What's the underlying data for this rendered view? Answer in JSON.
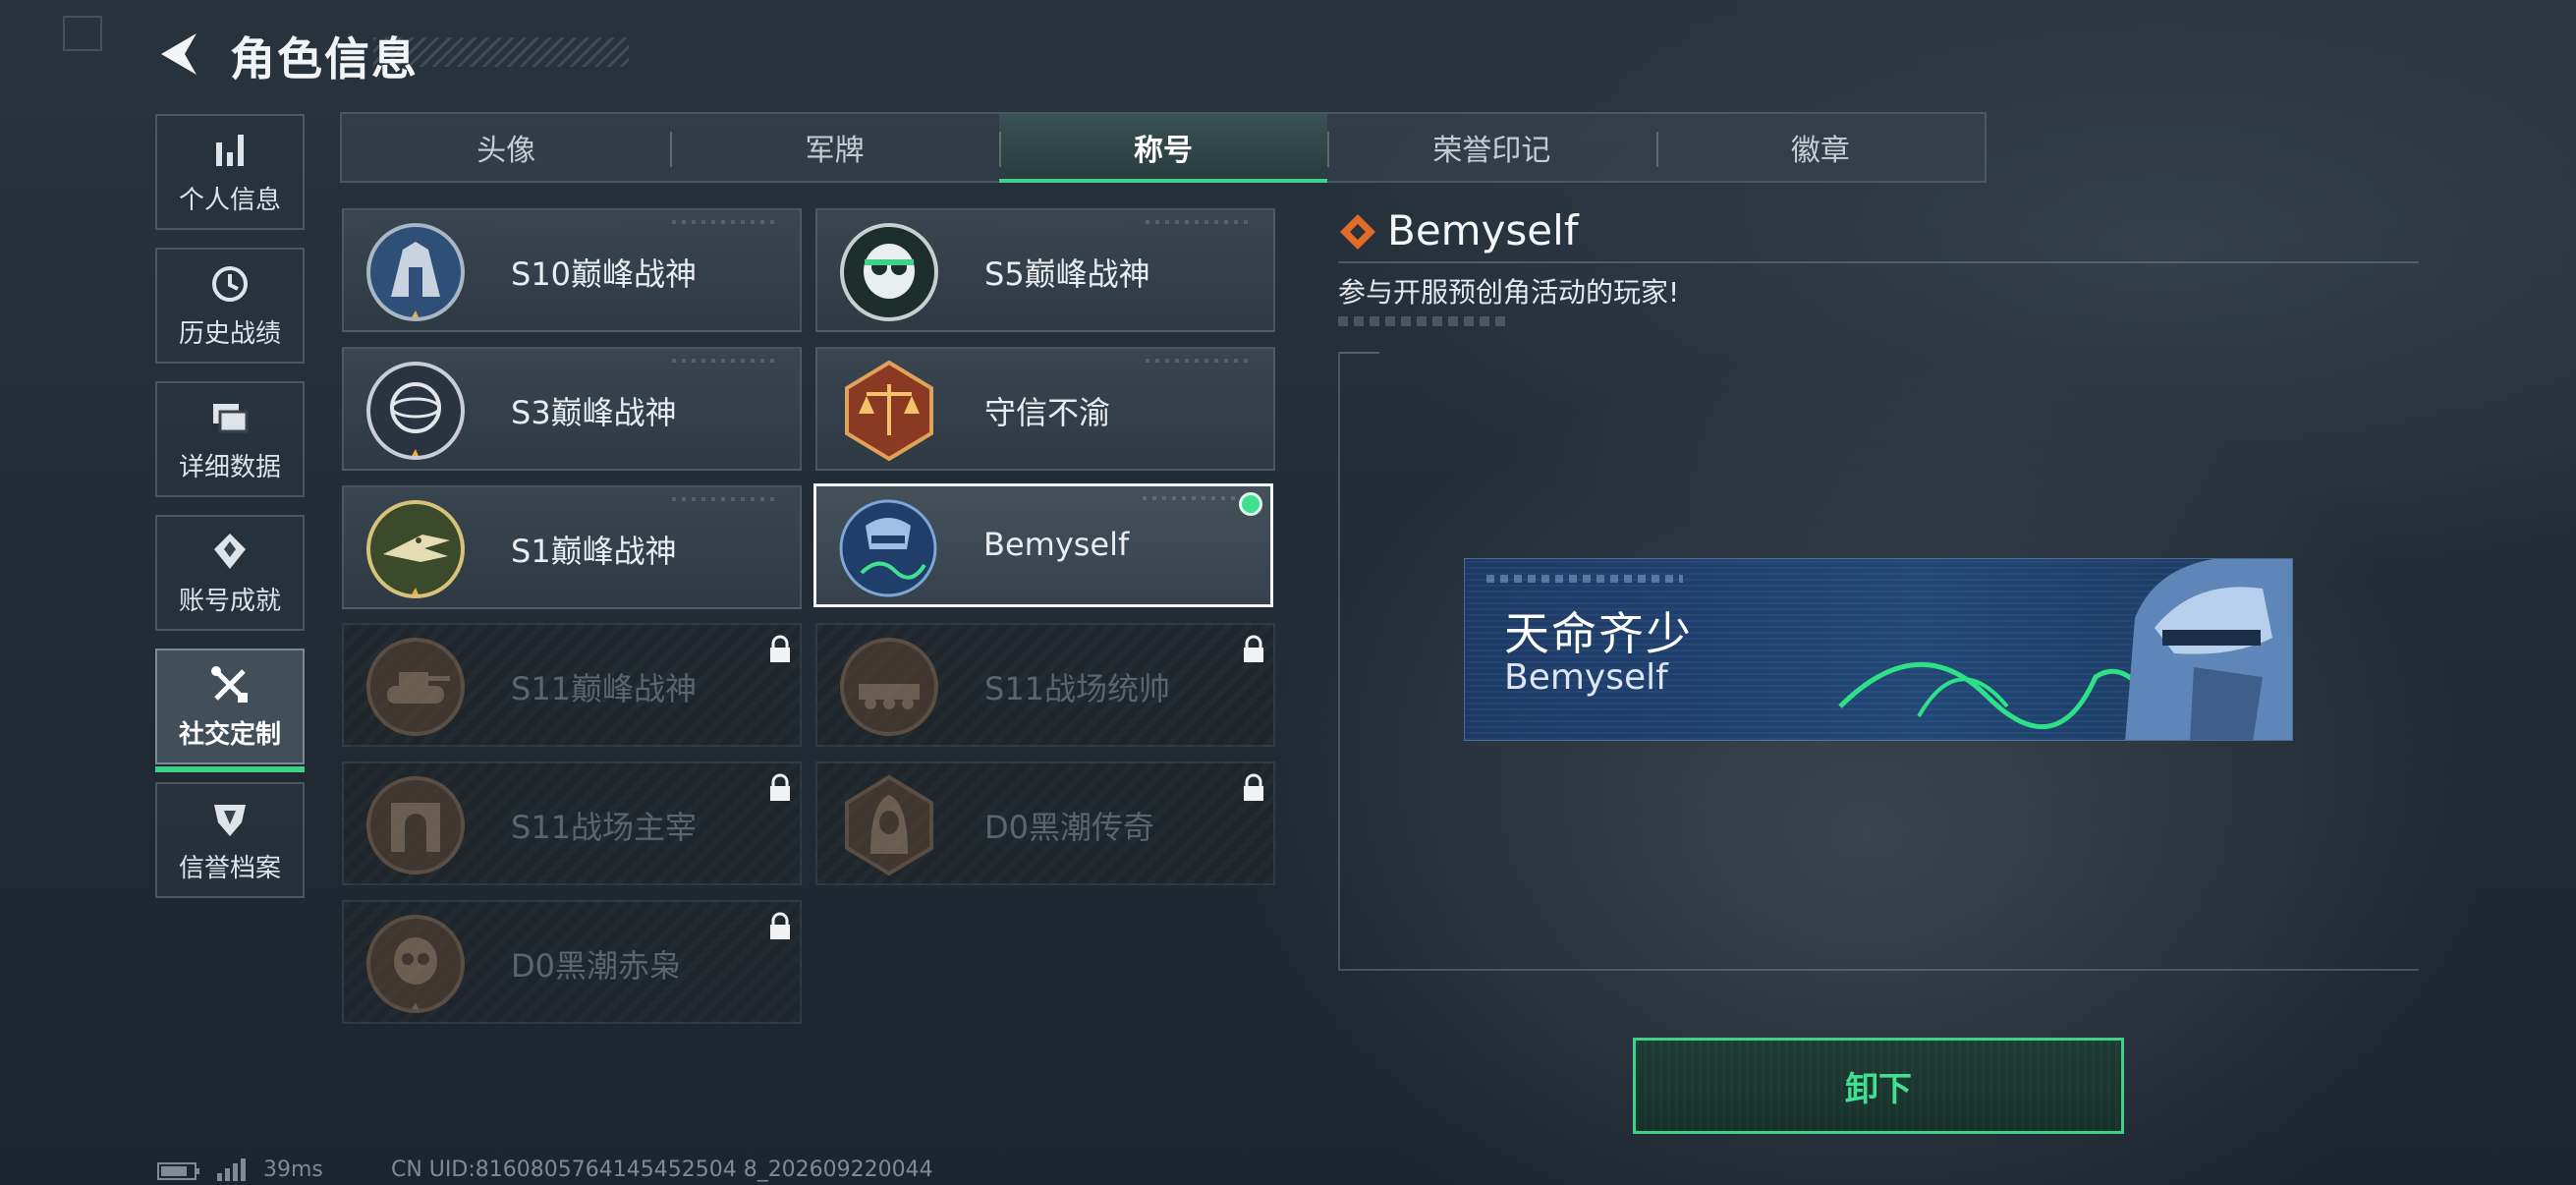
{
  "header": {
    "title": "角色信息",
    "back_icon": "back-arrow-icon"
  },
  "sidebar": {
    "items": [
      {
        "label": "个人信息",
        "icon": "bar-chart-icon",
        "active": false
      },
      {
        "label": "历史战绩",
        "icon": "history-clock-icon",
        "active": false
      },
      {
        "label": "详细数据",
        "icon": "folder-stack-icon",
        "active": false
      },
      {
        "label": "账号成就",
        "icon": "achievement-emblem-icon",
        "active": false
      },
      {
        "label": "社交定制",
        "icon": "tools-icon",
        "active": true
      },
      {
        "label": "信誉档案",
        "icon": "shield-badge-icon",
        "active": false
      }
    ]
  },
  "tabs": [
    {
      "label": "头像",
      "active": false
    },
    {
      "label": "军牌",
      "active": false
    },
    {
      "label": "称号",
      "active": true
    },
    {
      "label": "荣誉印记",
      "active": false
    },
    {
      "label": "徽章",
      "active": false
    }
  ],
  "titles": [
    {
      "label": "S10巅峰战神",
      "locked": false,
      "selected": false,
      "equipped": false,
      "emblem": "s10-peak-emblem-icon"
    },
    {
      "label": "S5巅峰战神",
      "locked": false,
      "selected": false,
      "equipped": false,
      "emblem": "s5-skull-emblem-icon"
    },
    {
      "label": "S3巅峰战神",
      "locked": false,
      "selected": false,
      "equipped": false,
      "emblem": "s3-globe-emblem-icon"
    },
    {
      "label": "守信不渝",
      "locked": false,
      "selected": false,
      "equipped": false,
      "emblem": "scales-emblem-icon"
    },
    {
      "label": "S1巅峰战神",
      "locked": false,
      "selected": false,
      "equipped": false,
      "emblem": "s1-crocodile-emblem-icon"
    },
    {
      "label": "Bemyself",
      "locked": false,
      "selected": true,
      "equipped": true,
      "emblem": "bemyself-soldier-emblem-icon"
    },
    {
      "label": "S11巅峰战神",
      "locked": true,
      "selected": false,
      "equipped": false,
      "emblem": "s11-tank-emblem-icon"
    },
    {
      "label": "S11战场统帅",
      "locked": true,
      "selected": false,
      "equipped": false,
      "emblem": "s11-vehicle-emblem-icon"
    },
    {
      "label": "S11战场主宰",
      "locked": true,
      "selected": false,
      "equipped": false,
      "emblem": "s11-arch-emblem-icon"
    },
    {
      "label": "D0黑潮传奇",
      "locked": true,
      "selected": false,
      "equipped": false,
      "emblem": "d0-hooded-emblem-icon"
    },
    {
      "label": "D0黑潮赤枭",
      "locked": true,
      "selected": false,
      "equipped": false,
      "emblem": "d0-skull-emblem-icon"
    }
  ],
  "detail": {
    "name": "Bemyself",
    "description": "参与开服预创角活动的玩家!",
    "banner_title": "天命齐少",
    "banner_subtitle": "Bemyself"
  },
  "actions": {
    "unequip_label": "卸下"
  },
  "footer": {
    "ping": "39ms",
    "uid": "CN UID:8160805764145452504 8_202609220044"
  },
  "colors": {
    "accent": "#3fd08a",
    "equipped": "#3fe08f",
    "banner_bg": "#214776"
  }
}
